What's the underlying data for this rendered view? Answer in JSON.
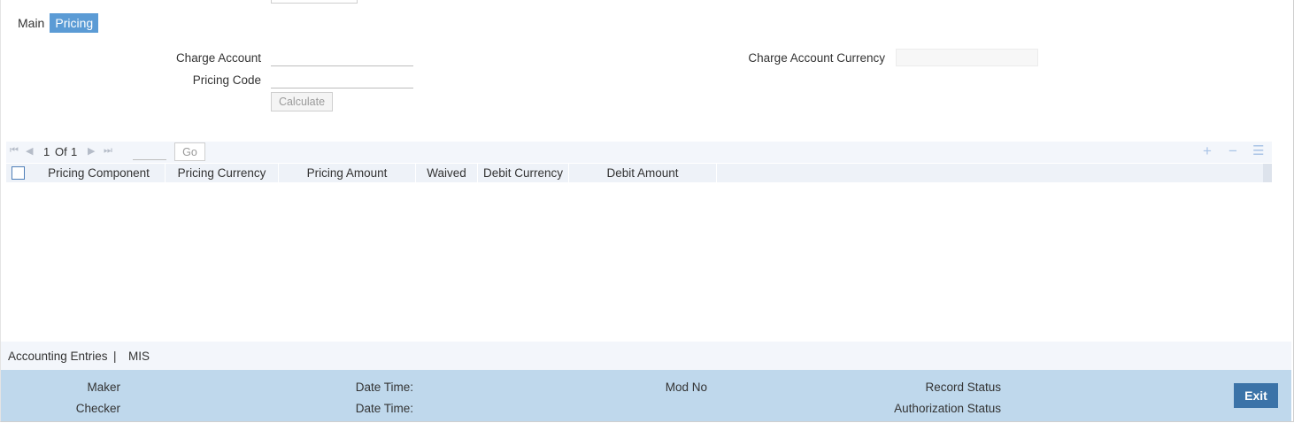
{
  "tabs": [
    {
      "label": "Main"
    },
    {
      "label": "Pricing"
    }
  ],
  "form": {
    "charge_account_label": "Charge Account",
    "charge_account_value": "",
    "pricing_code_label": "Pricing Code",
    "pricing_code_value": "",
    "charge_account_currency_label": "Charge Account Currency",
    "charge_account_currency_value": "",
    "calculate_label": "Calculate"
  },
  "pager": {
    "current": "1",
    "of_label": "Of",
    "total": "1",
    "go_label": "Go",
    "page_input": ""
  },
  "grid": {
    "columns": [
      "Pricing Component",
      "Pricing Currency",
      "Pricing Amount",
      "Waived",
      "Debit Currency",
      "Debit Amount"
    ],
    "rows": []
  },
  "links": {
    "accounting_entries": "Accounting Entries",
    "separator": "|",
    "mis": "MIS"
  },
  "footer": {
    "maker_label": "Maker",
    "checker_label": "Checker",
    "date_time_label": "Date Time:",
    "mod_no_label": "Mod No",
    "record_status_label": "Record Status",
    "authorization_status_label": "Authorization Status",
    "exit_label": "Exit"
  },
  "colors": {
    "active_tab": "#5b9bd5",
    "footer_bg": "#bfd8ec",
    "exit_button": "#3b73a8"
  }
}
